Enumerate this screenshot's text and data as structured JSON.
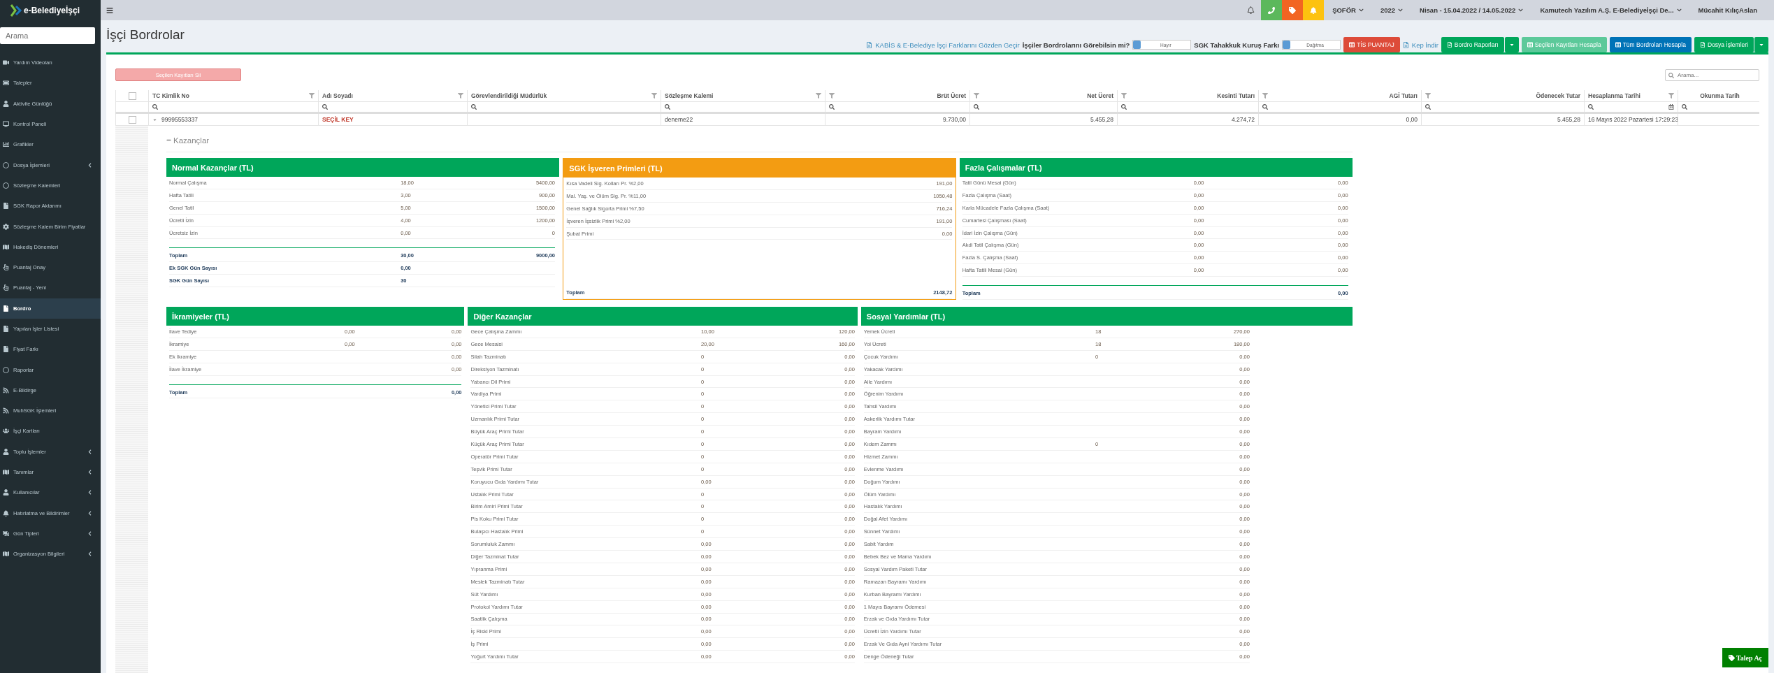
{
  "logo": {
    "text": "e-Belediyeİşçi"
  },
  "sidebar": {
    "search": {
      "placeholder": "Arama"
    },
    "items": [
      {
        "label": "Yardım Videoları",
        "selected": false,
        "expandable": false
      },
      {
        "label": "Talepler",
        "selected": false,
        "expandable": false
      },
      {
        "label": "Aktivite Günlüğü",
        "selected": false,
        "expandable": false
      },
      {
        "label": "Kontrol Paneli",
        "selected": false,
        "expandable": false
      },
      {
        "label": "Grafikler",
        "selected": false,
        "expandable": false
      },
      {
        "label": "Dosya İşlemleri",
        "selected": false,
        "expandable": true
      },
      {
        "label": "Sözleşme Kalemleri",
        "selected": false,
        "expandable": false
      },
      {
        "label": "SGK Rapor Aktarımı",
        "selected": false,
        "expandable": false
      },
      {
        "label": "Sözleşme Kalem Birim Fiyatlar",
        "selected": false,
        "expandable": false
      },
      {
        "label": "Hakediş Dönemleri",
        "selected": false,
        "expandable": false
      },
      {
        "label": "Puantaj Onay",
        "selected": false,
        "expandable": false
      },
      {
        "label": "Puantaj - Yeni",
        "selected": false,
        "expandable": false
      },
      {
        "label": "Bordro",
        "selected": true,
        "expandable": false
      },
      {
        "label": "Yapılan İşler Listesi",
        "selected": false,
        "expandable": false
      },
      {
        "label": "Fiyat Farkı",
        "selected": false,
        "expandable": false
      },
      {
        "label": "Raporlar",
        "selected": false,
        "expandable": false
      },
      {
        "label": "E-Bildirge",
        "selected": false,
        "expandable": false
      },
      {
        "label": "MuhSGK İşlemleri",
        "selected": false,
        "expandable": false
      },
      {
        "label": "İşçi Kartları",
        "selected": false,
        "expandable": false
      },
      {
        "label": "Toplu İşlemler",
        "selected": false,
        "expandable": true
      },
      {
        "label": "Tanımlar",
        "selected": false,
        "expandable": true
      },
      {
        "label": "Kullanıcılar",
        "selected": false,
        "expandable": true
      },
      {
        "label": "Hatırlatma ve Bildirimler",
        "selected": false,
        "expandable": true
      },
      {
        "label": "Gün Tipleri",
        "selected": false,
        "expandable": true
      },
      {
        "label": "Organizasyon Bilgileri",
        "selected": false,
        "expandable": true
      }
    ]
  },
  "topbar": {
    "menus": [
      "ŞOFÖR",
      "2022",
      "Nisan - 15.04.2022 / 14.05.2022",
      "Kamutech Yazılım A.Ş. E-Belediyeİşçi De..."
    ],
    "user": "Mücahit KılıçAslan"
  },
  "page": {
    "title": "İşçi Bordrolar"
  },
  "toolbar": {
    "review_link": "KABİS & E-Belediye İşçi Farklarını Gözden Geçir",
    "toggles": [
      {
        "label": "İşçiler Bordrolarını Görebilsin mi?",
        "value": "Hayır",
        "on": false
      },
      {
        "label": "SGK Tahakkuk Kuruş Farkı",
        "value": "Dağıtma",
        "on": false
      }
    ],
    "tis_button": "TİS PUANTAJ",
    "kep_link": "Kep İndir",
    "buttons": [
      {
        "label": "Bordro Raporları",
        "kind": "split"
      },
      {
        "label": "Seçilen Kayıtları Hesapla",
        "kind": "light"
      },
      {
        "label": "Tüm Bordroları Hesapla",
        "kind": "blue"
      },
      {
        "label": "Dosya İşlemleri",
        "kind": "split"
      }
    ]
  },
  "delete_button": {
    "label": "Seçilen Kayıtları Sil",
    "disabled": true
  },
  "table_search": {
    "placeholder": "Arama..."
  },
  "table": {
    "all_checked": false,
    "columns": [
      {
        "label": "TC Kimlik No",
        "numeric": false,
        "filterable": true,
        "highlight": false
      },
      {
        "label": "Adı Soyadı",
        "numeric": false,
        "filterable": true,
        "highlight": true
      },
      {
        "label": "Görevlendirildiği Müdürlük",
        "numeric": false,
        "filterable": true,
        "highlight": false
      },
      {
        "label": "Sözleşme Kalemi",
        "numeric": false,
        "filterable": true,
        "highlight": false
      },
      {
        "label": "Brüt Ücret",
        "numeric": true,
        "filterable": true,
        "highlight": false
      },
      {
        "label": "Net Ücret",
        "numeric": true,
        "filterable": true,
        "highlight": false
      },
      {
        "label": "Kesinti Tutarı",
        "numeric": true,
        "filterable": true,
        "highlight": false
      },
      {
        "label": "AGİ Tutarı",
        "numeric": true,
        "filterable": true,
        "highlight": false
      },
      {
        "label": "Ödenecek Tutar",
        "numeric": true,
        "filterable": true,
        "highlight": false
      },
      {
        "label": "Hesaplanma Tarihi",
        "numeric": false,
        "filterable": true,
        "highlight": false
      },
      {
        "label": "Okunma Tarih",
        "numeric": false,
        "filterable": false
      }
    ],
    "rows": [
      {
        "checked": false,
        "expanded": true,
        "cells": [
          "99995553337",
          "SEÇİL KEY",
          null,
          "deneme22",
          "9.730,00",
          "5.455,28",
          "4.274,72",
          "0,00",
          "5.455,28",
          "16 Mayıs 2022 Pazartesi 17:29:23",
          null
        ]
      }
    ]
  },
  "detail": {
    "section": "Kazançlar",
    "panel_rows": [
      [
        {
          "title": "Normal Kazançlar (TL)",
          "color": "#00a65a",
          "bordered": false,
          "rows": [
            {
              "label": "Normal Çalışma",
              "quantity": "18,00",
              "amount": "5400,00"
            },
            {
              "label": "Hafta Tatili",
              "quantity": "3,00",
              "amount": "900,00"
            },
            {
              "label": "Genel Tatil",
              "quantity": "5,00",
              "amount": "1500,00"
            },
            {
              "label": "Ücretli İzin",
              "quantity": "4,00",
              "amount": "1200,00"
            },
            {
              "label": "Ücretsiz İzin",
              "quantity": "0,00",
              "amount": "0"
            }
          ],
          "totals": [
            {
              "label": "Toplam",
              "quantity": "30,00",
              "amount": "9000,00"
            },
            {
              "label": "Ek SGK Gün Sayısı",
              "quantity": "0,00"
            },
            {
              "label": "SGK Gün Sayısı",
              "quantity": "30"
            }
          ]
        },
        {
          "title": "SGK İşveren Primleri (TL)",
          "color": "#f39c12",
          "bordered": true,
          "rows": [
            {
              "label": "Kısa Vadeli Sig. Kolları Pr. %2,00",
              "amount": "191,00"
            },
            {
              "label": "Mal. Yaş. ve Ölüm Sig. Pr. %11,00",
              "amount": "1050,48"
            },
            {
              "label": "Genel Sağlık Sigorta Primi %7,50",
              "amount": "716,24"
            },
            {
              "label": "İşveren İşsizlik Primi %2,00",
              "amount": "191,00"
            },
            {
              "label": "Şubat Primi",
              "amount": "0,00"
            }
          ],
          "totals": [
            {
              "label": "Toplam",
              "amount": "2148,72"
            }
          ]
        },
        {
          "title": "Fazla Çalışmalar (TL)",
          "color": "#00a65a",
          "bordered": false,
          "rows": [
            {
              "label": "Tatil Günü Mesai (Gün)",
              "quantity": "0,00",
              "amount": "0,00"
            },
            {
              "label": "Fazla Çalışma (Saat)",
              "quantity": "0,00",
              "amount": "0,00"
            },
            {
              "label": "Karla Mücadele Fazla Çalışma (Saat)",
              "quantity": "0,00",
              "amount": "0,00"
            },
            {
              "label": "Cumartesi Çalışması (Saat)",
              "quantity": "0,00",
              "amount": "0,00"
            },
            {
              "label": "İdari İzin Çalışma (Gün)",
              "quantity": "0,00",
              "amount": "0,00"
            },
            {
              "label": "Akdi Tatil Çalışma (Gün)",
              "quantity": "0,00",
              "amount": "0,00"
            },
            {
              "label": "Fazla S. Çalışma (Saat)",
              "quantity": "0,00",
              "amount": "0,00"
            },
            {
              "label": "Hafta Tatili Mesai (Gün)",
              "quantity": "0,00",
              "amount": "0,00"
            }
          ],
          "totals": [
            {
              "label": "Toplam",
              "amount": "0,00"
            }
          ]
        }
      ],
      [
        {
          "title": "İkramiyeler (TL)",
          "color": "#00a65a",
          "bordered": false,
          "rows": [
            {
              "label": "İlave Tediye",
              "quantity": "0,00",
              "amount": "0,00"
            },
            {
              "label": "İkramiye",
              "quantity": "0,00",
              "amount": "0,00"
            },
            {
              "label": "Ek İkramiye",
              "amount": "0,00"
            },
            {
              "label": "İlave İkramiye",
              "amount": "0,00"
            }
          ],
          "totals": [
            {
              "label": "Toplam",
              "amount": "0,00"
            }
          ]
        },
        {
          "title": "Diğer Kazançlar",
          "color": "#00a65a",
          "bordered": false,
          "rows": [
            {
              "label": "Gece Çalışma Zammı",
              "quantity": "10,00",
              "amount": "120,00"
            },
            {
              "label": "Gece Mesaisi",
              "quantity": "20,00",
              "amount": "160,00"
            },
            {
              "label": "Silah Tazminatı",
              "quantity": "0",
              "amount": "0,00"
            },
            {
              "label": "Direksiyon Tazminatı",
              "quantity": "0",
              "amount": "0,00"
            },
            {
              "label": "Yabancı Dil Primi",
              "quantity": "0",
              "amount": "0,00"
            },
            {
              "label": "Vardiya Primi",
              "quantity": "0",
              "amount": "0,00"
            },
            {
              "label": "Yönetici Primi Tutar",
              "quantity": "0",
              "amount": "0,00"
            },
            {
              "label": "Uzmanlık Primi Tutar",
              "quantity": "0",
              "amount": "0,00"
            },
            {
              "label": "Büyük Araç Primi Tutar",
              "quantity": "0",
              "amount": "0,00"
            },
            {
              "label": "Küçük Araç Primi Tutar",
              "quantity": "0",
              "amount": "0,00"
            },
            {
              "label": "Operatör Primi Tutar",
              "quantity": "0",
              "amount": "0,00"
            },
            {
              "label": "Teşvik Primi Tutar",
              "quantity": "0",
              "amount": "0,00"
            },
            {
              "label": "Koruyucu Gıda Yardımı Tutar",
              "quantity": "0,00",
              "amount": "0,00"
            },
            {
              "label": "Ustalık Primi Tutar",
              "quantity": "0",
              "amount": "0,00"
            },
            {
              "label": "Birim Amiri Primi Tutar",
              "quantity": "0",
              "amount": "0,00"
            },
            {
              "label": "Pis Koku Primi Tutar",
              "quantity": "0",
              "amount": "0,00"
            },
            {
              "label": "Bulaşıcı Hastalık Primi",
              "quantity": "0",
              "amount": "0,00"
            },
            {
              "label": "Sorumluluk Zammı",
              "quantity": "0,00",
              "amount": "0,00"
            },
            {
              "label": "Diğer Tazminat Tutar",
              "quantity": "0,00",
              "amount": "0,00"
            },
            {
              "label": "Yıpranma Primi",
              "quantity": "0,00",
              "amount": "0,00"
            },
            {
              "label": "Meslek Tazminatı Tutar",
              "quantity": "0,00",
              "amount": "0,00"
            },
            {
              "label": "Süt Yardımı",
              "quantity": "0,00",
              "amount": "0,00"
            },
            {
              "label": "Protokol Yardımı Tutar",
              "quantity": "0,00",
              "amount": "0,00"
            },
            {
              "label": "Saatlik Çalışma",
              "quantity": "0,00",
              "amount": "0,00"
            },
            {
              "label": "İş Riski Primi",
              "quantity": "0,00",
              "amount": "0,00"
            },
            {
              "label": "İş Primi",
              "quantity": "0,00",
              "amount": "0,00"
            },
            {
              "label": "Yoğurt Yardımı Tutar",
              "quantity": "0,00",
              "amount": "0,00"
            }
          ]
        },
        {
          "title": "Sosyal Yardımlar (TL)",
          "color": "#00a65a",
          "bordered": false,
          "rows": [
            {
              "label": "Yemek Ücreti",
              "quantity": "18",
              "amount": "270,00"
            },
            {
              "label": "Yol Ücreti",
              "quantity": "18",
              "amount": "180,00"
            },
            {
              "label": "Çocuk Yardımı",
              "quantity": "0",
              "amount": "0,00"
            },
            {
              "label": "Yakacak Yardımı",
              "amount": "0,00"
            },
            {
              "label": "Aile Yardımı",
              "amount": "0,00"
            },
            {
              "label": "Öğrenim Yardımı",
              "amount": "0,00"
            },
            {
              "label": "Tahsil Yardımı",
              "amount": "0,00"
            },
            {
              "label": "Askerlik Yardımı Tutar",
              "amount": "0,00"
            },
            {
              "label": "Bayram Yardımı",
              "amount": "0,00"
            },
            {
              "label": "Kıdem Zammı",
              "quantity": "0",
              "amount": "0,00"
            },
            {
              "label": "Hizmet Zammı",
              "amount": "0,00"
            },
            {
              "label": "Evlenme Yardımı",
              "amount": "0,00"
            },
            {
              "label": "Doğum Yardımı",
              "amount": "0,00"
            },
            {
              "label": "Ölüm Yardımı",
              "amount": "0,00"
            },
            {
              "label": "Hastalık Yardımı",
              "amount": "0,00"
            },
            {
              "label": "Doğal Afet Yardımı",
              "amount": "0,00"
            },
            {
              "label": "Sünnet Yardımı",
              "amount": "0,00"
            },
            {
              "label": "Sabit Yardım",
              "amount": "0,00"
            },
            {
              "label": "Bebek Bez ve Mama Yardımı",
              "amount": "0,00"
            },
            {
              "label": "Sosyal Yardım Paketi Tutar",
              "amount": "0,00"
            },
            {
              "label": "Ramazan Bayramı Yardımı",
              "amount": "0,00"
            },
            {
              "label": "Kurban Bayramı Yardımı",
              "amount": "0,00"
            },
            {
              "label": "1 Mayıs Bayramı Ödemesi",
              "amount": "0,00"
            },
            {
              "label": "Erzak ve Gıda Yardımı Tutar",
              "amount": "0,00"
            },
            {
              "label": "Ücretli İzin Yardımı Tutar",
              "amount": "0,00"
            },
            {
              "label": "Erzak Ve Gıda Ayni Yardımı Tutar",
              "amount": "0,00"
            },
            {
              "label": "Denge Ödeneği Tutar",
              "amount": "0,00"
            }
          ]
        }
      ]
    ]
  },
  "help_button": {
    "label": "Talep Aç"
  }
}
